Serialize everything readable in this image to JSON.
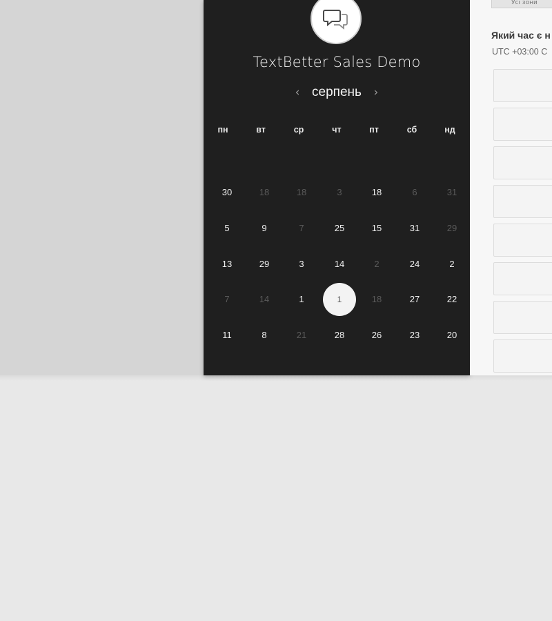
{
  "app": {
    "title": "TextBetter Sales Demo",
    "logo_icon": "chat-bubbles-icon"
  },
  "calendar": {
    "month": "серпень",
    "prev_icon": "chevron-left-icon",
    "next_icon": "chevron-right-icon",
    "prev_symbol": "‹",
    "next_symbol": "›",
    "weekdays": [
      "пн",
      "вт",
      "ср",
      "чт",
      "пт",
      "сб",
      "нд"
    ],
    "weeks": [
      [
        {
          "d": "30",
          "a": true
        },
        {
          "d": "18",
          "a": false
        },
        {
          "d": "18",
          "a": false
        },
        {
          "d": "3",
          "a": false
        },
        {
          "d": "18",
          "a": true
        },
        {
          "d": "6",
          "a": false
        },
        {
          "d": "31",
          "a": false
        }
      ],
      [
        {
          "d": "5",
          "a": true
        },
        {
          "d": "9",
          "a": true
        },
        {
          "d": "7",
          "a": false
        },
        {
          "d": "25",
          "a": true
        },
        {
          "d": "15",
          "a": true
        },
        {
          "d": "31",
          "a": true
        },
        {
          "d": "29",
          "a": false
        }
      ],
      [
        {
          "d": "13",
          "a": true
        },
        {
          "d": "29",
          "a": true
        },
        {
          "d": "3",
          "a": true
        },
        {
          "d": "14",
          "a": true
        },
        {
          "d": "2",
          "a": false
        },
        {
          "d": "24",
          "a": true
        },
        {
          "d": "2",
          "a": true
        }
      ],
      [
        {
          "d": "7",
          "a": false
        },
        {
          "d": "14",
          "a": false
        },
        {
          "d": "1",
          "a": true
        },
        {
          "d": "1",
          "a": true,
          "selected": true
        },
        {
          "d": "18",
          "a": false
        },
        {
          "d": "27",
          "a": true
        },
        {
          "d": "22",
          "a": true
        }
      ],
      [
        {
          "d": "11",
          "a": true
        },
        {
          "d": "8",
          "a": true
        },
        {
          "d": "21",
          "a": false
        },
        {
          "d": "28",
          "a": true
        },
        {
          "d": "26",
          "a": true
        },
        {
          "d": "23",
          "a": true
        },
        {
          "d": "20",
          "a": true
        }
      ]
    ]
  },
  "timezone": {
    "question": "Який час є н",
    "value": "UTC +03:00 С"
  },
  "top_button": {
    "label": "Усі зони"
  },
  "time_slots": [
    "",
    "",
    "",
    "",
    "",
    "",
    "",
    ""
  ]
}
